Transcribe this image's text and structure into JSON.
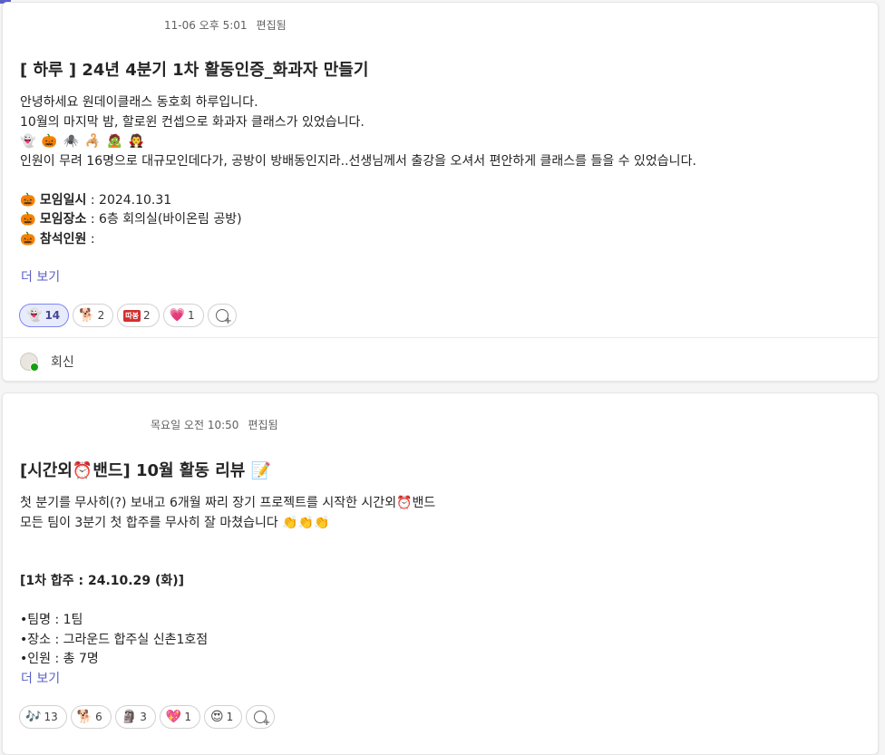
{
  "post1": {
    "timestamp": "11-06 오후 5:01",
    "edited": "편집됨",
    "title": "[ 하루 ] 24년 4분기 1차 활동인증_화과자 만들기",
    "lines": [
      "안녕하세요 원데이클래스 동호회 하루입니다.",
      "10월의 마지막 밤, 할로윈 컨셉으로 화과자 클래스가 있었습니다.",
      "인원이 무려 16명으로 대규모인데다가, 공방이 방배동인지라..선생님께서 출강을 오셔서 편안하게 클래스를 들을 수 있었습니다."
    ],
    "emojis": [
      "👻",
      "🎃",
      "🕷️",
      "🦂",
      "🧟",
      "🧛"
    ],
    "details": [
      {
        "icon": "🎃",
        "label": "모임일시",
        "value": " : 2024.10.31"
      },
      {
        "icon": "🎃",
        "label": "모임장소",
        "value": " : 6층 회의실(바이온림 공방)"
      },
      {
        "icon": "🎃",
        "label": "참석인원",
        "value": " :"
      }
    ],
    "more": "더 보기",
    "reactions": [
      {
        "emoji": "👻",
        "count": "14"
      },
      {
        "emoji": "🐕",
        "count": "2"
      },
      {
        "emoji": "따봉",
        "count": "2"
      },
      {
        "emoji": "💗",
        "count": "1"
      }
    ],
    "reply": "회신"
  },
  "post2": {
    "timestamp": "목요일 오전 10:50",
    "edited": "편집됨",
    "title_parts": [
      "[시간외",
      "⏰",
      "밴드] 10월 활동 리뷰 ",
      "📝"
    ],
    "line1_parts": [
      "첫 분기를 무사히(?) 보내고 6개월 짜리 장기 프로젝트를 시작한 시간외",
      "⏰",
      "밴드"
    ],
    "line2": "모든 팀이 3분기 첫 합주를 무사히 잘 마쳤습니다 👏👏👏",
    "section": "[1차 합주 : 24.10.29 (화)]",
    "items": [
      "•팀명 : 1팀",
      "•장소 : 그라운드 합주실 신촌1호점",
      "•인원 : 총 7명"
    ],
    "more": "더 보기",
    "reactions": [
      {
        "emoji": "🎶",
        "count": "13"
      },
      {
        "emoji": "🐕",
        "count": "6"
      },
      {
        "emoji": "🗿",
        "count": "3"
      },
      {
        "emoji": "💖",
        "count": "1"
      },
      {
        "emoji": "😍",
        "count": "1"
      }
    ]
  }
}
